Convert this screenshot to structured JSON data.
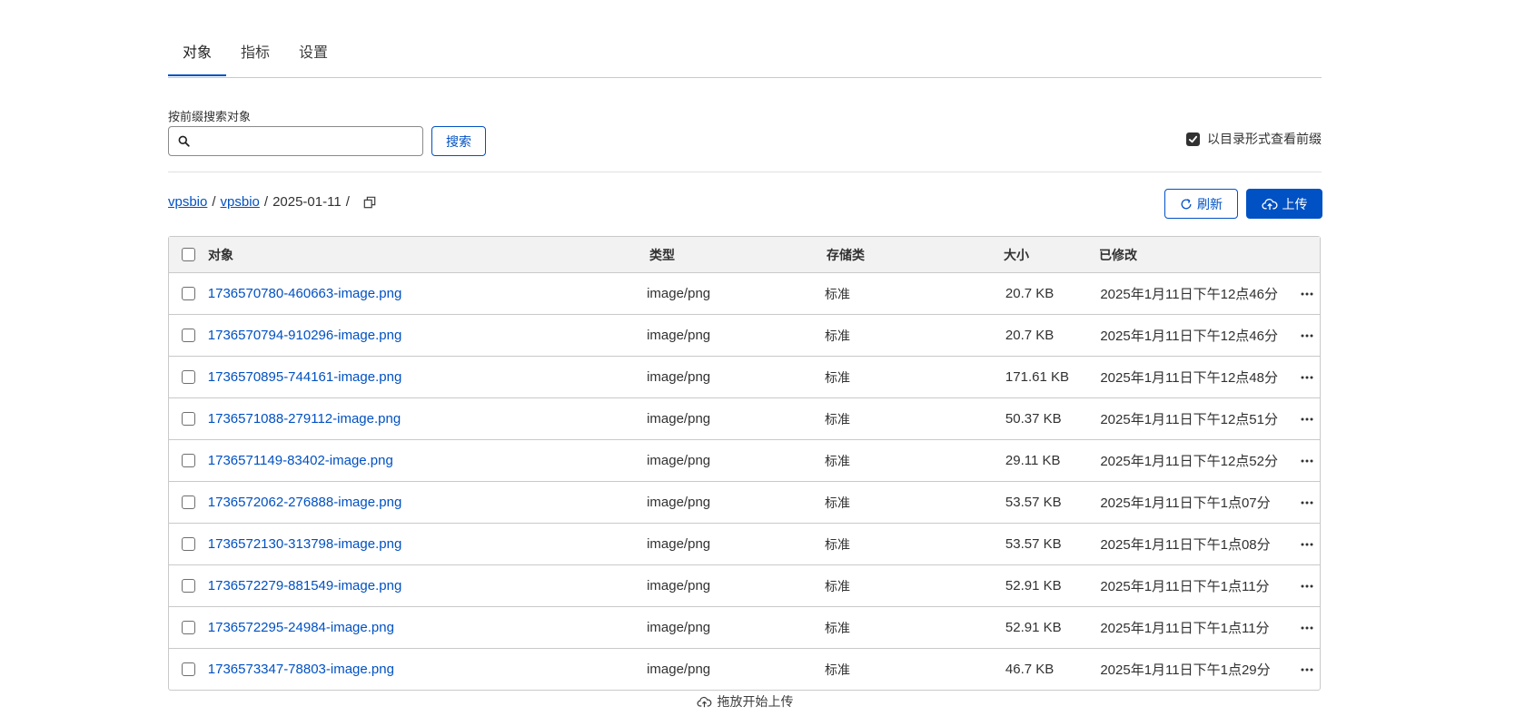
{
  "tabs": [
    {
      "label": "对象",
      "active": true
    },
    {
      "label": "指标",
      "active": false
    },
    {
      "label": "设置",
      "active": false
    }
  ],
  "search": {
    "label": "按前缀搜索对象",
    "value": "",
    "placeholder": "",
    "button_label": "搜索"
  },
  "directory_toggle": {
    "label": "以目录形式查看前缀",
    "checked": true
  },
  "breadcrumb": {
    "items": [
      "vpsbio",
      "vpsbio",
      "2025-01-11"
    ]
  },
  "actions": {
    "refresh_label": "刷新",
    "upload_label": "上传"
  },
  "table": {
    "headers": {
      "object": "对象",
      "type": "类型",
      "storage_class": "存储类",
      "size": "大小",
      "modified": "已修改"
    },
    "rows": [
      {
        "name": "1736570780-460663-image.png",
        "type": "image/png",
        "storage_class": "标准",
        "size": "20.7 KB",
        "modified": "2025年1月11日下午12点46分"
      },
      {
        "name": "1736570794-910296-image.png",
        "type": "image/png",
        "storage_class": "标准",
        "size": "20.7 KB",
        "modified": "2025年1月11日下午12点46分"
      },
      {
        "name": "1736570895-744161-image.png",
        "type": "image/png",
        "storage_class": "标准",
        "size": "171.61 KB",
        "modified": "2025年1月11日下午12点48分"
      },
      {
        "name": "1736571088-279112-image.png",
        "type": "image/png",
        "storage_class": "标准",
        "size": "50.37 KB",
        "modified": "2025年1月11日下午12点51分"
      },
      {
        "name": "1736571149-83402-image.png",
        "type": "image/png",
        "storage_class": "标准",
        "size": "29.11 KB",
        "modified": "2025年1月11日下午12点52分"
      },
      {
        "name": "1736572062-276888-image.png",
        "type": "image/png",
        "storage_class": "标准",
        "size": "53.57 KB",
        "modified": "2025年1月11日下午1点07分"
      },
      {
        "name": "1736572130-313798-image.png",
        "type": "image/png",
        "storage_class": "标准",
        "size": "53.57 KB",
        "modified": "2025年1月11日下午1点08分"
      },
      {
        "name": "1736572279-881549-image.png",
        "type": "image/png",
        "storage_class": "标准",
        "size": "52.91 KB",
        "modified": "2025年1月11日下午1点11分"
      },
      {
        "name": "1736572295-24984-image.png",
        "type": "image/png",
        "storage_class": "标准",
        "size": "52.91 KB",
        "modified": "2025年1月11日下午1点11分"
      },
      {
        "name": "1736573347-78803-image.png",
        "type": "image/png",
        "storage_class": "标准",
        "size": "46.7 KB",
        "modified": "2025年1月11日下午1点29分"
      }
    ]
  },
  "dropzone": {
    "label": "拖放开始上传"
  },
  "colors": {
    "accent": "#0051c3",
    "border": "#c9c9c9",
    "header_bg": "#f2f2f2"
  }
}
